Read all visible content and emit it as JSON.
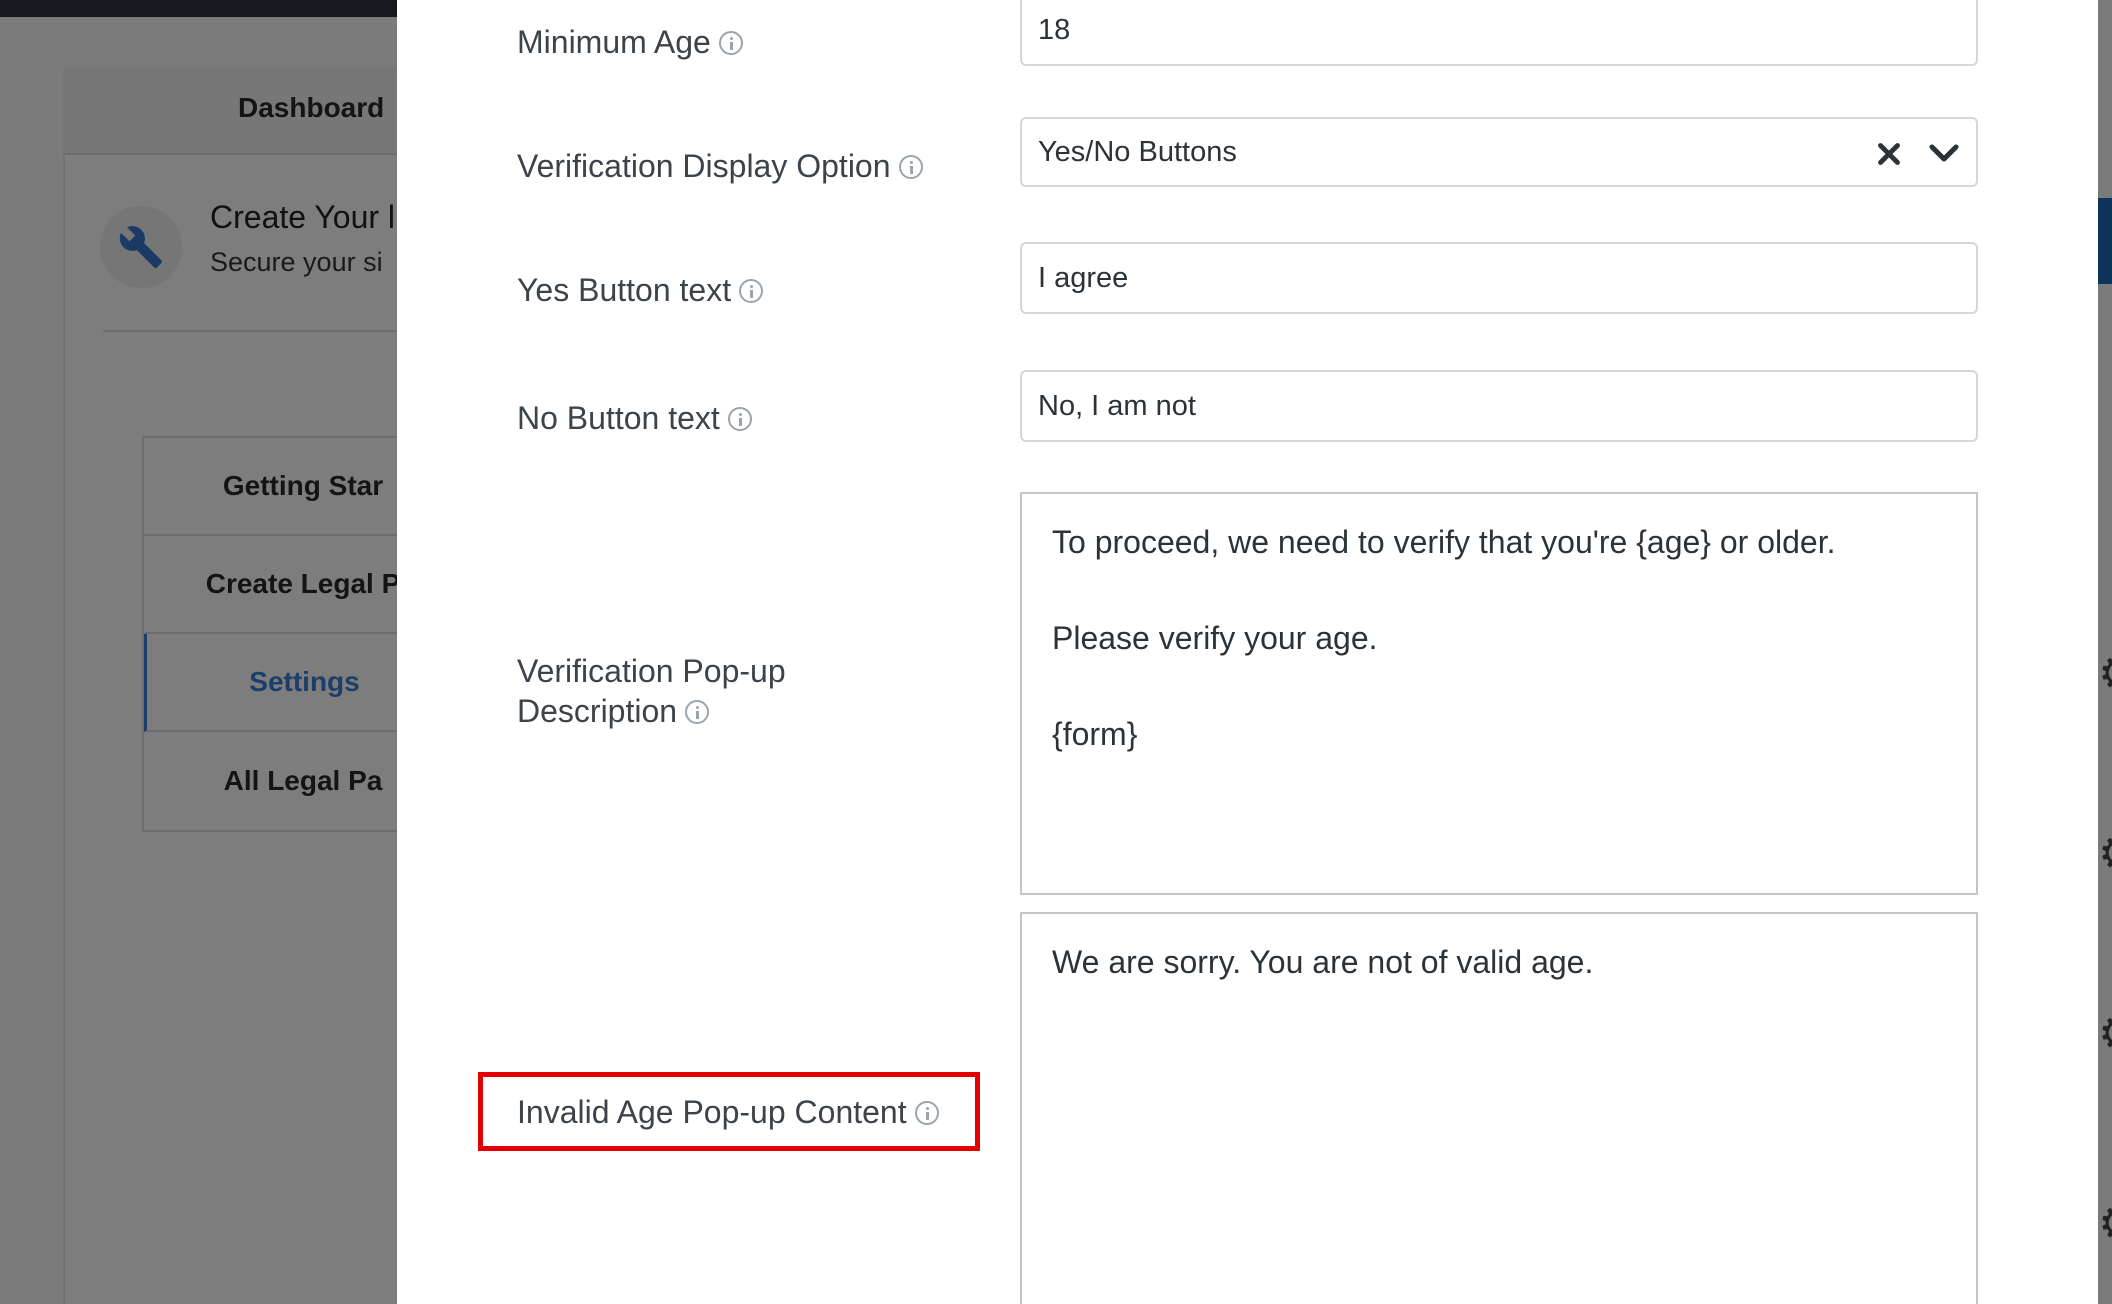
{
  "background": {
    "dashboard_tab": "Dashboard",
    "header_title": "Create Your l",
    "header_subtitle": "Secure your si",
    "menu": [
      {
        "label": "Getting Star",
        "active": false
      },
      {
        "label": "Create Legal P",
        "active": false
      },
      {
        "label": "Settings",
        "active": true
      },
      {
        "label": "All Legal Pa",
        "active": false
      }
    ]
  },
  "form": {
    "minimum_age": {
      "label": "Minimum Age",
      "value": "18"
    },
    "display_option": {
      "label": "Verification Display Option",
      "value": "Yes/No Buttons"
    },
    "yes_button": {
      "label": "Yes Button text",
      "value": "I agree"
    },
    "no_button": {
      "label": "No Button text",
      "value": "No, I am not"
    },
    "popup_description": {
      "label_line1": "Verification Pop-up",
      "label_line2": "Description",
      "paragraphs": [
        "To proceed, we need to verify that you're {age} or older.",
        "Please verify your age.",
        "{form}"
      ]
    },
    "invalid_age": {
      "label": "Invalid Age Pop-up Content",
      "value": "We are sorry. You are not of valid age."
    }
  },
  "colors": {
    "highlight": "#e40000",
    "active_menu": "#1c3e6b",
    "overlay": "#7b7b7b"
  },
  "icons": [
    "wrench-icon",
    "info-icon",
    "clear-icon",
    "chevron-down-icon",
    "gear-icon"
  ]
}
